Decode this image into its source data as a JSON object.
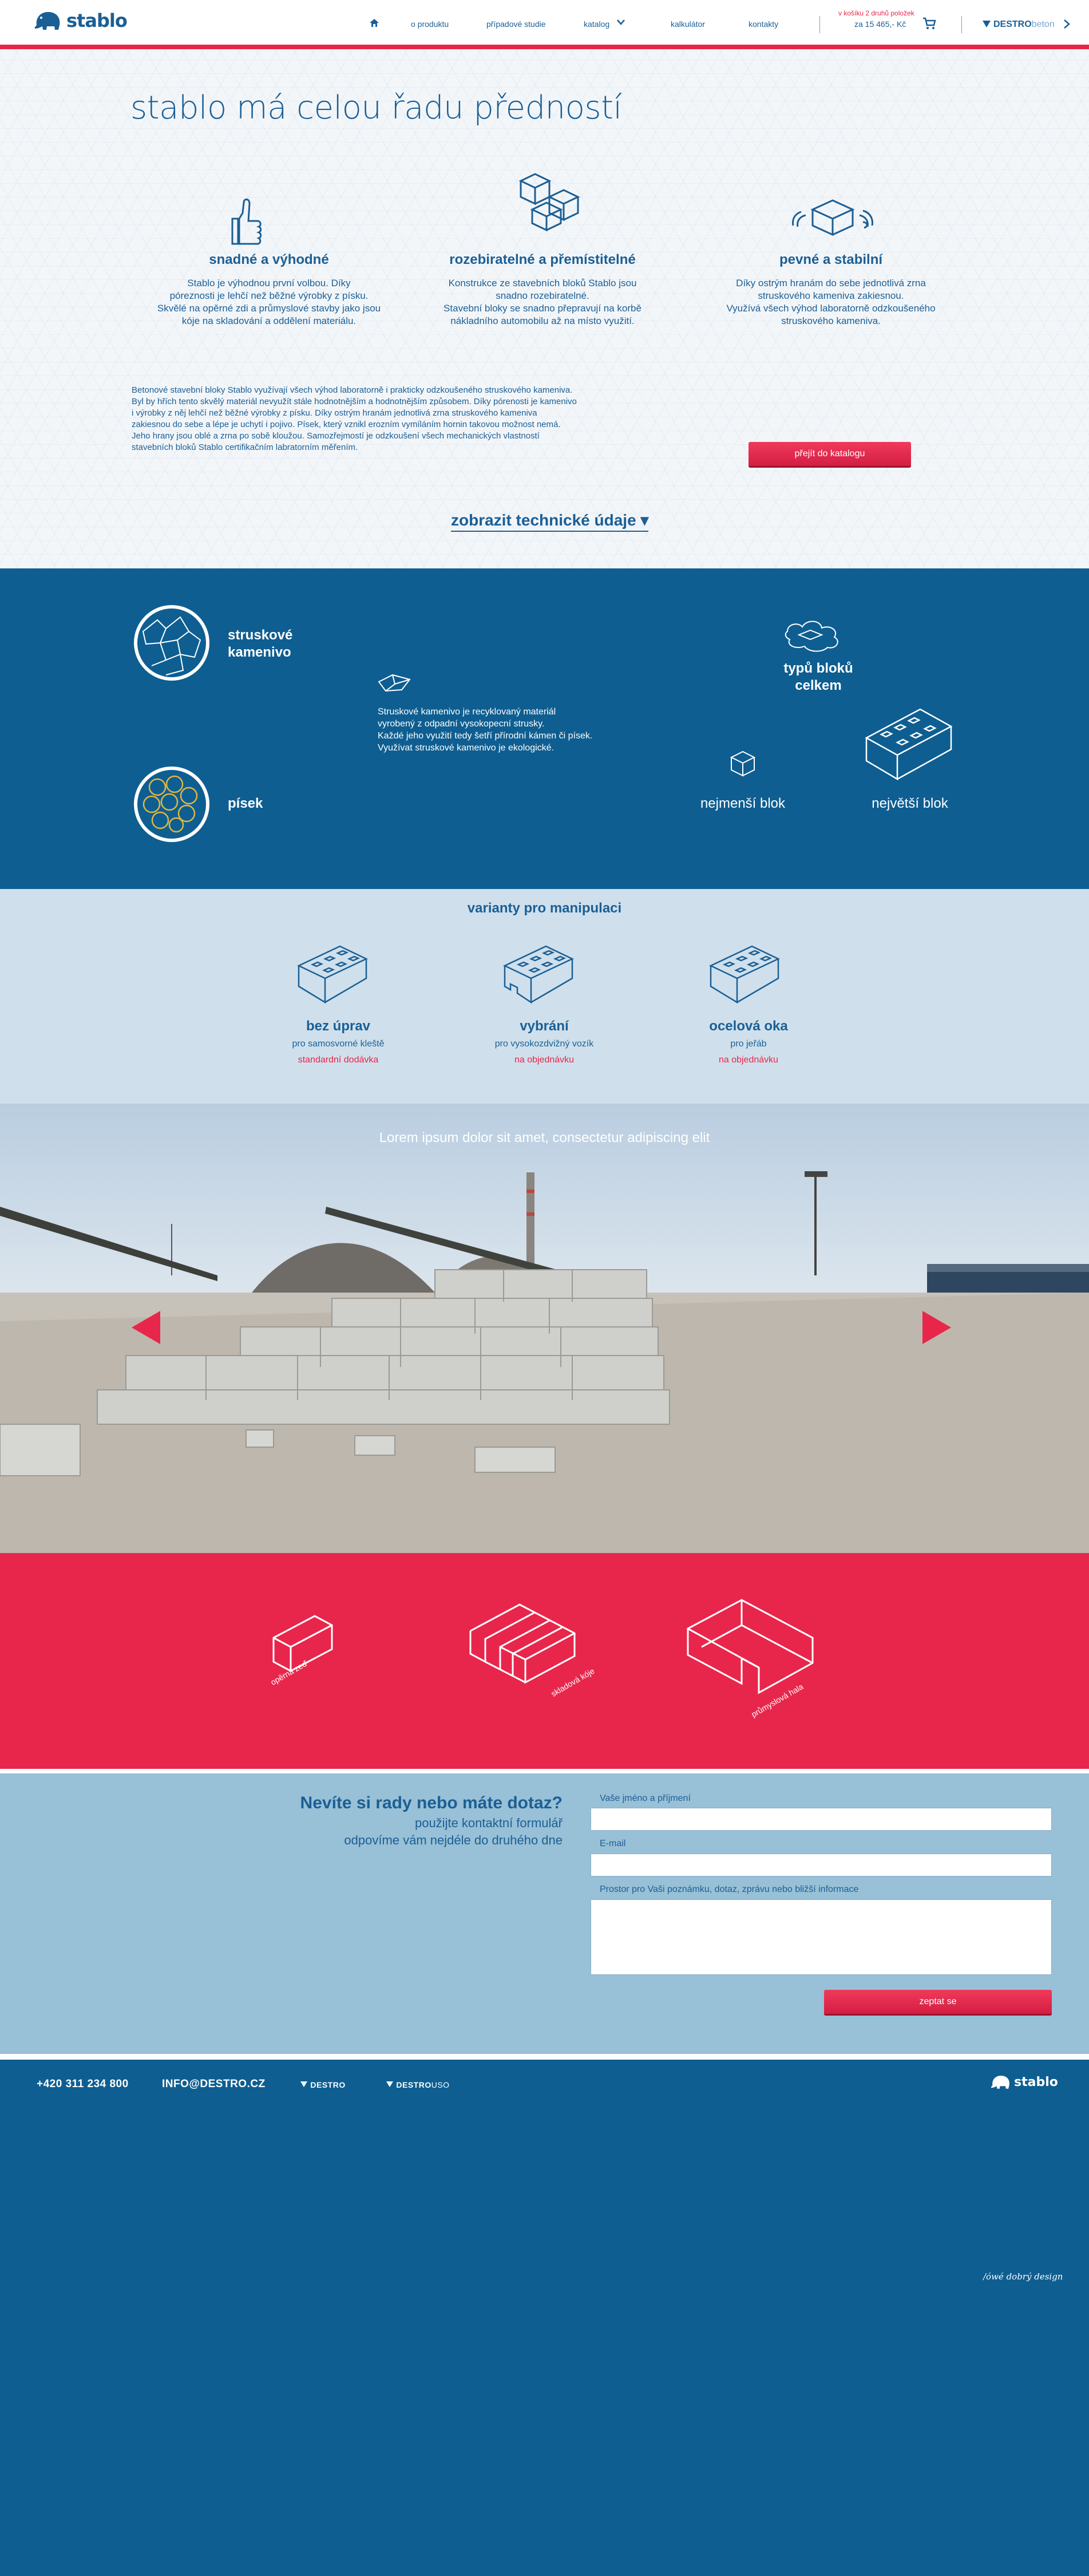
{
  "header": {
    "logo_text": "stablo",
    "nav": [
      "o produktu",
      "případové studie",
      "katalog",
      "kalkulátor",
      "kontakty"
    ],
    "cart_note": "v košíku 2 druhů položek",
    "cart_price": "za 15 465,- Kč",
    "brand_destro": "DESTRO",
    "brand_beton": "beton"
  },
  "advantages": {
    "heading": "stablo má celou řadu předností",
    "features": [
      {
        "title": "snadné a výhodné",
        "text": "Stablo je výhodnou první volbou. Díky\npóreznosti je lehčí než běžné výrobky z písku.\nSkvělé na opěrné zdi a průmyslové stavby jako jsou\nkóje na skladování a oddělení materiálu."
      },
      {
        "title": "rozebiratelné a přemístitelné",
        "text": "Konstrukce ze stavebních bloků Stablo jsou\nsnadno rozebiratelné.\nStavební bloky se snadno přepravují na korbě\nnákladního automobilu až na místo využití."
      },
      {
        "title": "pevné a stabilní",
        "text": "Díky ostrým hranám do sebe jednotlivá zrna\nstruskového kameniva zakiesnou.\nVyužívá všech výhod laboratorně odzkoušeného\nstruskového kameniva."
      }
    ],
    "paragraph": "Betonové stavební bloky Stablo využívají všech výhod laboratorně i prakticky odzkoušeného struskového kameniva. Byl by hřích tento skvělý materiál nevyužít stále hodnotnějším a hodnotnějším způsobem. Díky pórenosti je kamenivo i výrobky z něj lehčí než běžné výrobky z písku. Díky ostrým hranám jednotlivá zrna struskového kameniva zakiesnou do sebe a lépe je uchytí i pojivo. Písek, který vznikl erozním vymíláním hornin takovou možnost nemá. Jeho hrany jsou oblé a zrna po sobě kloužou. Samozřejmostí je odzkoušení všech mechanických vlastností stavebních bloků Stablo certifikačním labratorním měřením.",
    "catalog_button": "přejít do katalogu",
    "tech_link": "zobrazit technické údaje ▾"
  },
  "stats": {
    "stone_label": "struskové\nkamenivo",
    "sand_label": "písek",
    "description": "Struskové kamenivo je recyklovaný materiál\nvyrobený z odpadní vysokopecní strusky.\nKaždé jeho využití tedy šetří přírodní kámen či písek.\nVyužívat struskové kamenivo je ekologické.",
    "types_label": "typů bloků celkem",
    "smallest_label": "nejmenší blok",
    "largest_label": "největší blok"
  },
  "variants": {
    "title": "varianty pro manipulaci",
    "items": [
      {
        "name": "bez úprav",
        "sub": "pro samosvorné kleště",
        "tag": "standardní dodávka"
      },
      {
        "name": "vybrání",
        "sub": "pro vysokozdvižný vozík",
        "tag": "na objednávku"
      },
      {
        "name": "ocelová oka",
        "sub": "pro jeřáb",
        "tag": "na objednávku"
      }
    ]
  },
  "gallery": {
    "caption": "Lorem ipsum dolor sit amet, consectetur adipiscing elit"
  },
  "uses": {
    "items": [
      "opěrná zeď",
      "skladová kóje",
      "průmyslová hala"
    ]
  },
  "contact": {
    "title": "Nevíte si rady nebo máte dotaz?",
    "subtitle": "použijte kontaktní formulář\nodpovíme vám nejdéle do druhého dne",
    "name_label": "Vaše jméno a příjmení",
    "email_label": "E-mail",
    "message_label": "Prostor pro Vaši poznámku, dotaz, zprávu nebo bližší informace",
    "submit": "zeptat se"
  },
  "footer": {
    "phone": "+420 311 234 800",
    "email": "INFO@DESTRO.CZ",
    "brand1": "DESTRO",
    "brand2": "DESTRO",
    "brand2_suffix": "USO",
    "logo_text": "stablo",
    "credits": "/ówé dobrý design"
  },
  "colors": {
    "brand_blue": "#1b5f95",
    "accent_red": "#e8264b",
    "dark_blue": "#0e5e91",
    "light_blue": "#cfe0ec"
  }
}
